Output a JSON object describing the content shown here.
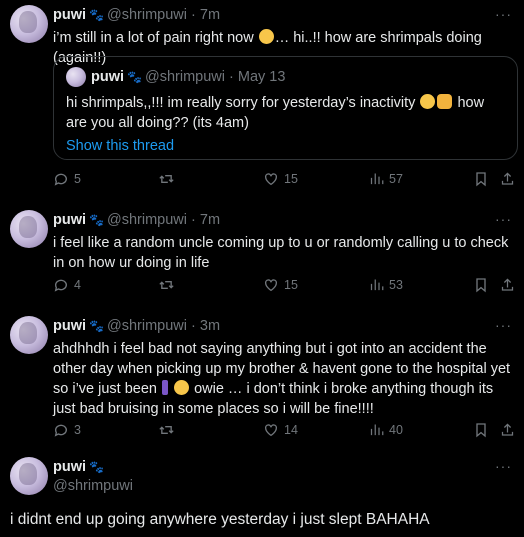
{
  "tweets": [
    {
      "name": "puwi",
      "handle": "@shrimpuwi",
      "dot": "·",
      "time": "7m",
      "text_pre": "i’m still in a lot of pain right now ",
      "text_post": "… hi..!! how are shrimpals doing (again!!)",
      "quote": {
        "name": "puwi",
        "handle": "@shrimpuwi",
        "dot": "·",
        "time": "May 13",
        "text_pre": "hi shrimpals,,!!! im really sorry for yesterday’s inactivity ",
        "text_post": " how are you all doing?? (its 4am)",
        "link": "Show this thread"
      },
      "replies": "5",
      "retweets": "",
      "likes": "15",
      "views": "57"
    },
    {
      "name": "puwi",
      "handle": "@shrimpuwi",
      "dot": "·",
      "time": "7m",
      "text": "i feel like a random uncle coming up to u or randomly calling u to check in on how ur doing in life",
      "replies": "4",
      "retweets": "",
      "likes": "15",
      "views": "53"
    },
    {
      "name": "puwi",
      "handle": "@shrimpuwi",
      "dot": "·",
      "time": "3m",
      "text_pre": "ahdhhdh i feel bad not saying anything but i got into an accident the other day when picking up my brother & havent gone to the hospital yet so i’ve just been ",
      "text_post": " owie … i don’t think i broke anything though its just bad bruising in some places so i will be fine!!!!",
      "replies": "3",
      "retweets": "",
      "likes": "14",
      "views": "40"
    },
    {
      "name": "puwi",
      "handle": "@shrimpuwi",
      "text": "i didnt end up going anywhere yesterday i just slept BAHAHA"
    }
  ],
  "icons": {
    "paw": "paw-icon",
    "more": "more-icon",
    "reply": "reply-icon",
    "retweet": "retweet-icon",
    "like": "heart-icon",
    "views": "views-icon",
    "bookmark": "bookmark-icon",
    "share": "share-icon"
  },
  "more_label": "···",
  "paw_glyph": "🐾",
  "colors": {
    "background": "#000000",
    "text": "#e7e9ea",
    "muted": "#71767b",
    "link": "#1d9bf0",
    "border": "#2f3336"
  }
}
